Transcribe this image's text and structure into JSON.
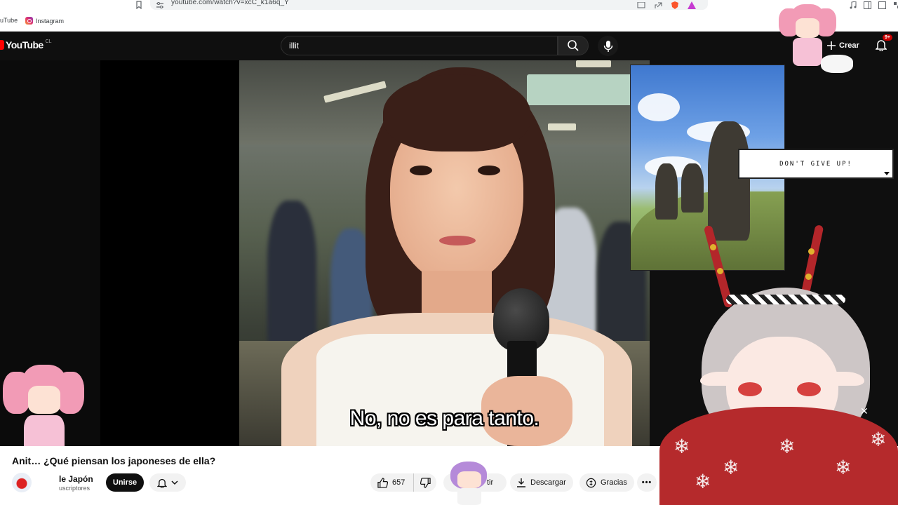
{
  "browser": {
    "url": "youtube.com/watch?v=xcC_k1a6q_Y",
    "bookmarks": [
      {
        "label": "uTube"
      },
      {
        "label": "Instagram"
      }
    ]
  },
  "masthead": {
    "logo_text": "YouTube",
    "country_code": "CL",
    "search_value": "illit",
    "create_label": "Crear",
    "notifications_count": "9+"
  },
  "player": {
    "subtitle": "No, no es para tanto."
  },
  "overlay": {
    "speech_bubble": "DON'T GIVE UP!"
  },
  "video": {
    "title": "Anit… ¿Qué piensan los japoneses de ella?",
    "channel_name": "le Japón",
    "channel_subs": "uscriptores",
    "join_label": "Unirse",
    "like_count": "657",
    "share_label": "tir",
    "download_label": "Descargar",
    "thanks_label": "Gracias",
    "more_label": "•••"
  },
  "colors": {
    "brand_red": "#ff0000",
    "bg_dark": "#0f0f0f",
    "notif_red": "#cc0000"
  }
}
